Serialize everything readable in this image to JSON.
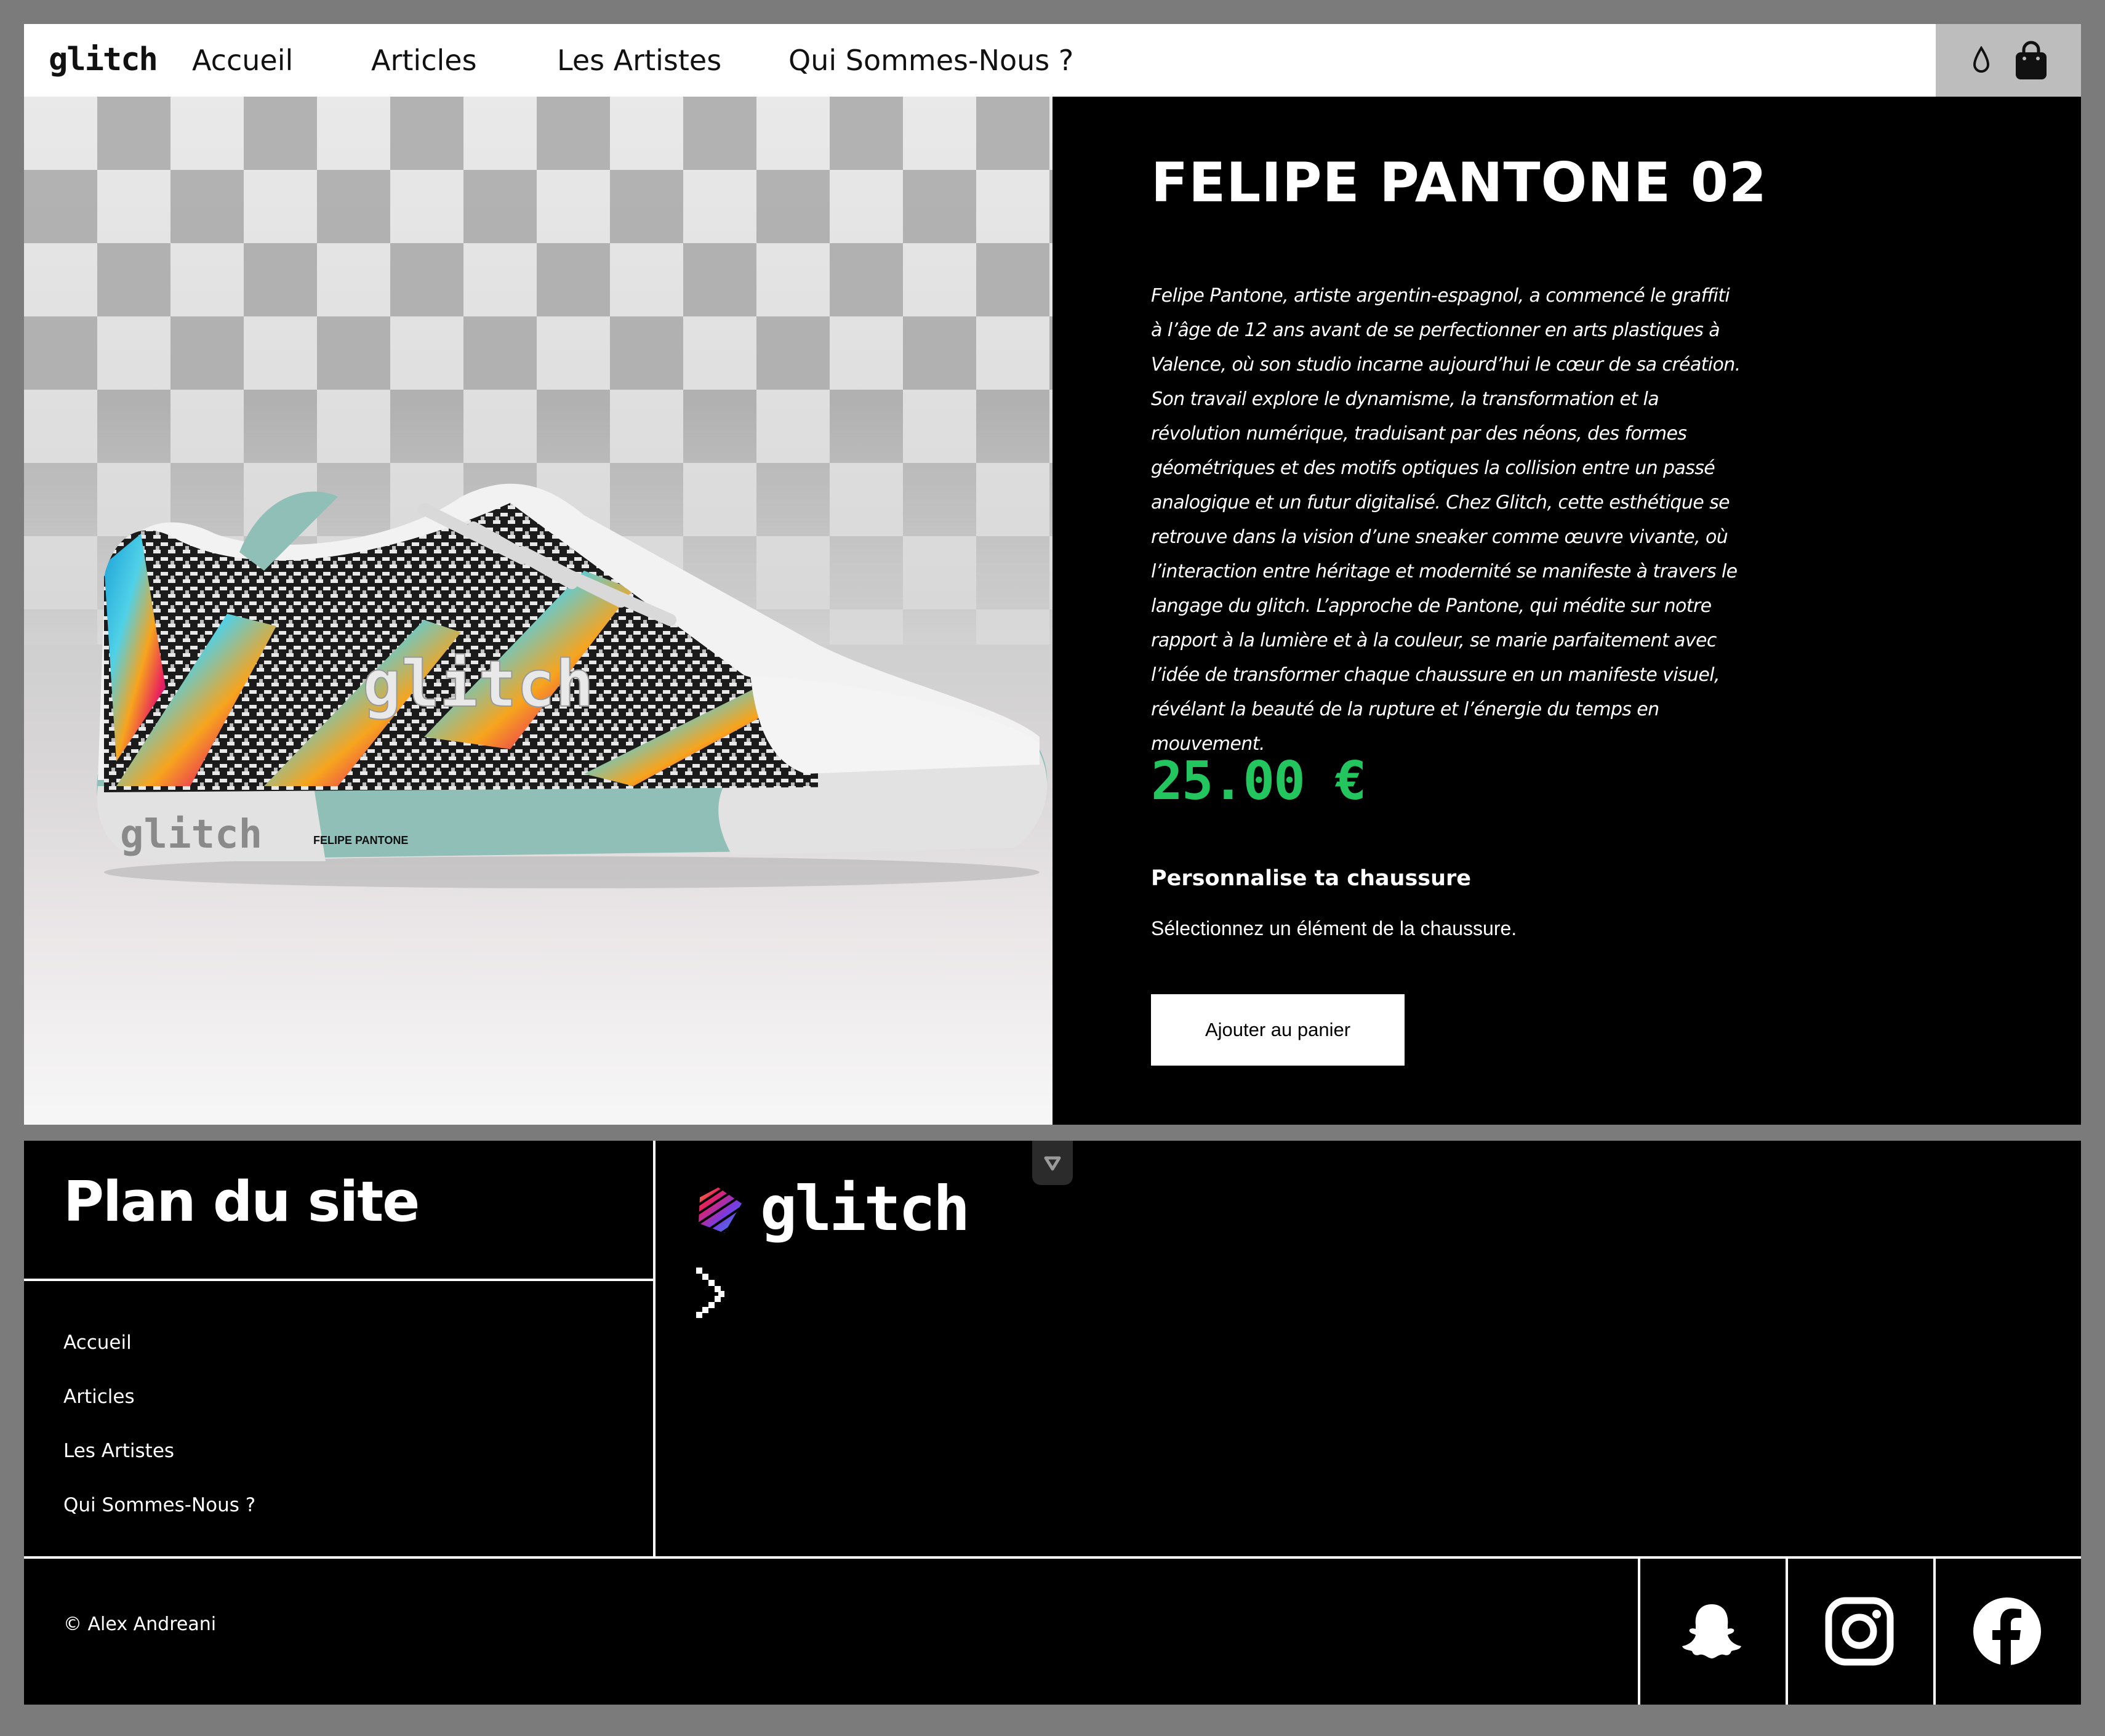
{
  "nav": {
    "logo": "glitch",
    "links": [
      "Accueil",
      "Articles",
      "Les Artistes",
      "Qui Sommes-Nous ?"
    ]
  },
  "product": {
    "image_brand": "glitch",
    "image_label": "FELIPE PANTONE",
    "title": "FELIPE PANTONE 02",
    "description": "Felipe Pantone, artiste argentin-espagnol, a commencé le graffiti à l’âge de 12 ans avant de se perfectionner en arts plastiques à Valence, où son studio incarne aujourd’hui le cœur de sa création. Son travail explore le dynamisme, la transformation et la révolution numérique, traduisant par des néons, des formes géométriques et des motifs optiques la collision entre un passé analogique et un futur digitalisé. Chez Glitch, cette esthétique se retrouve dans la vision d’une sneaker comme œuvre vivante, où l’interaction entre héritage et modernité se manifeste à travers le langage du glitch. L’approche de Pantone, qui médite sur notre rapport à la lumière et à la couleur, se marie parfaitement avec l’idée de transformer chaque chaussure en un manifeste visuel, révélant la beauté de la rupture et l’énergie du temps en mouvement.",
    "price": "25.00 €",
    "price_color": "#22c55e",
    "customize_title": "Personnalise ta chaussure",
    "customize_hint": "Sélectionnez un élément de la chaussure.",
    "add_to_cart": "Ajouter au panier"
  },
  "footer": {
    "sitemap_title": "Plan du site",
    "links": [
      "Accueil",
      "Articles",
      "Les Artistes",
      "Qui Sommes-Nous ?"
    ],
    "logo": "glitch",
    "copyright": "© Alex Andreani",
    "social_icons": [
      "snapchat-icon",
      "instagram-icon",
      "facebook-icon"
    ]
  }
}
